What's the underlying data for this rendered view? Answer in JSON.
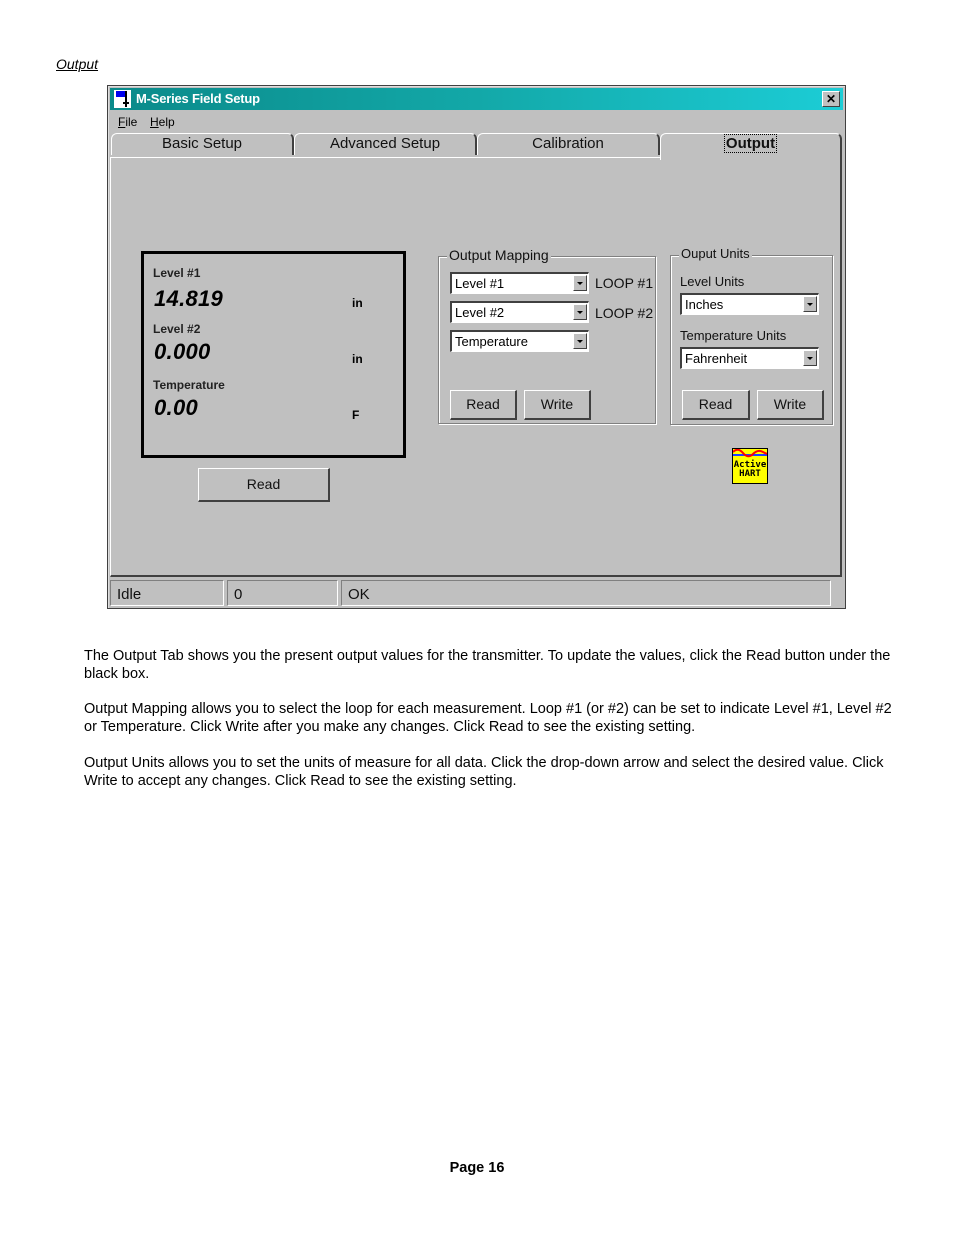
{
  "document": {
    "section_heading": "Output",
    "paragraphs": [
      "The Output Tab shows you the present output values for the transmitter.  To update the values, click the Read button under the black box.",
      "Output Mapping allows you to select the loop for each measurement.  Loop #1 (or #2) can be set to indicate Level #1, Level #2 or Temperature.  Click Write after you make any changes.  Click Read to see the existing setting.",
      "Output Units allows you to set the units of measure for all data.  Click the drop-down arrow and select the desired value.  Click Write to accept any changes.  Click Read to see the existing setting."
    ],
    "page_number": "Page 16"
  },
  "window": {
    "title": "M-Series Field Setup",
    "close_glyph": "✕",
    "menu": [
      {
        "label": "File",
        "accel": "F",
        "rest": "ile"
      },
      {
        "label": "Help",
        "accel": "H",
        "rest": "elp"
      }
    ],
    "tabs": [
      {
        "label": "Basic Setup",
        "active": false
      },
      {
        "label": "Advanced Setup",
        "active": false
      },
      {
        "label": "Calibration",
        "active": false
      },
      {
        "label": "Output",
        "active": true
      }
    ],
    "readouts": {
      "level1": {
        "label": "Level #1",
        "value": "14.819",
        "unit": "in"
      },
      "level2": {
        "label": "Level #2",
        "value": "0.000",
        "unit": "in"
      },
      "temperature": {
        "label": "Temperature",
        "value": "0.00",
        "unit": "F"
      },
      "read_button": "Read"
    },
    "output_mapping": {
      "title": "Output Mapping",
      "selects": [
        {
          "value": "Level #1",
          "loop_label": "LOOP #1"
        },
        {
          "value": "Level #2",
          "loop_label": "LOOP #2"
        },
        {
          "value": "Temperature",
          "loop_label": ""
        }
      ],
      "read_button": "Read",
      "write_button": "Write"
    },
    "output_units": {
      "title": "Ouput Units",
      "level_units_label": "Level Units",
      "level_units_value": "Inches",
      "temperature_units_label": "Temperature Units",
      "temperature_units_value": "Fahrenheit",
      "read_button": "Read",
      "write_button": "Write"
    },
    "hart_icon": {
      "line1": "Active",
      "line2": "HART"
    },
    "status_bar": [
      "Idle",
      "0",
      "OK"
    ]
  }
}
